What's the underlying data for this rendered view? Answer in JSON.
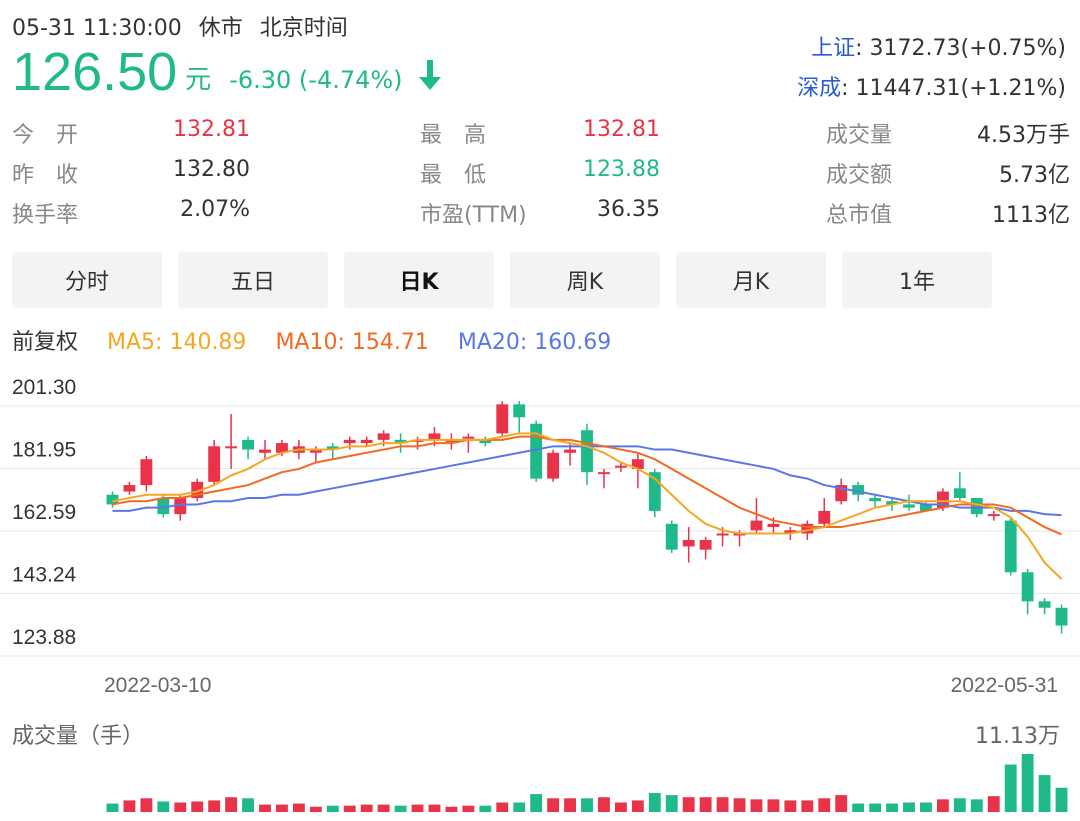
{
  "header": {
    "datetime": "05-31 11:30:00",
    "market_status": "休市",
    "timezone": "北京时间",
    "price": "126.50",
    "unit": "元",
    "change": "-6.30 (-4.74%)",
    "arrow_icon": "arrow-down-icon"
  },
  "indices": [
    {
      "name": "上证",
      "value": ": 3172.73(+0.75%)"
    },
    {
      "name": "深成",
      "value": ": 11447.31(+1.21%)"
    }
  ],
  "stats": {
    "open_label": "今　开",
    "open": "132.81",
    "prev_close_label": "昨　收",
    "prev_close": "132.80",
    "turnover_label": "换手率",
    "turnover": "2.07%",
    "high_label": "最　高",
    "high": "132.81",
    "low_label": "最　低",
    "low": "123.88",
    "pe_label": "市盈(TTM)",
    "pe": "36.35",
    "volume_label": "成交量",
    "volume": "4.53万手",
    "amount_label": "成交额",
    "amount": "5.73亿",
    "mktcap_label": "总市值",
    "mktcap": "1113亿"
  },
  "tabs": [
    "分时",
    "五日",
    "日K",
    "周K",
    "月K",
    "1年"
  ],
  "active_tab": 2,
  "ma": {
    "adjust": "前复权",
    "ma5": "MA5: 140.89",
    "ma10": "MA10: 154.71",
    "ma20": "MA20: 160.69"
  },
  "colors": {
    "up": "#e8334a",
    "down": "#1fb98b",
    "ma5": "#f5a623",
    "ma10": "#f26a21",
    "ma20": "#5b76e8"
  },
  "chart_data": {
    "type": "candlestick",
    "title": "",
    "y_ticks": [
      "201.30",
      "181.95",
      "162.59",
      "143.24",
      "123.88"
    ],
    "ylim": [
      123.88,
      201.3
    ],
    "x_labels": [
      "2022-03-10",
      "2022-05-31"
    ],
    "candles": [
      [
        167,
        164,
        168,
        163
      ],
      [
        168,
        170,
        171,
        167
      ],
      [
        170,
        178,
        179,
        168
      ],
      [
        166,
        161,
        167,
        160
      ],
      [
        161,
        166,
        167,
        159
      ],
      [
        166,
        171,
        172,
        165
      ],
      [
        171,
        182,
        184,
        170
      ],
      [
        182,
        182,
        192,
        175
      ],
      [
        184,
        181,
        185,
        178
      ],
      [
        180,
        181,
        184,
        178
      ],
      [
        180,
        183,
        184,
        179
      ],
      [
        180,
        182,
        184,
        178
      ],
      [
        180,
        181,
        182,
        177
      ],
      [
        182,
        181,
        183,
        178
      ],
      [
        183,
        184,
        185,
        181
      ],
      [
        183,
        184,
        185,
        182
      ],
      [
        184,
        186,
        187,
        182
      ],
      [
        184,
        183,
        186,
        180
      ],
      [
        184,
        184,
        185,
        181
      ],
      [
        184,
        186,
        188,
        182
      ],
      [
        184,
        184,
        186,
        181
      ],
      [
        185,
        185,
        186,
        180
      ],
      [
        184,
        183,
        185,
        182
      ],
      [
        186,
        195,
        196,
        185
      ],
      [
        195,
        191,
        196,
        186
      ],
      [
        189,
        172,
        190,
        171
      ],
      [
        172,
        180,
        181,
        171
      ],
      [
        180,
        181,
        183,
        176
      ],
      [
        187,
        174,
        189,
        170
      ],
      [
        174,
        174,
        175,
        169
      ],
      [
        176,
        176,
        177,
        174
      ],
      [
        175,
        178,
        180,
        169
      ],
      [
        174,
        162,
        175,
        160
      ],
      [
        158,
        150,
        159,
        149
      ],
      [
        151,
        153,
        157,
        146
      ],
      [
        150,
        153,
        154,
        147
      ],
      [
        155,
        155,
        157,
        151
      ],
      [
        155,
        155,
        156,
        151
      ],
      [
        156,
        159,
        166,
        155
      ],
      [
        157,
        158,
        160,
        155
      ],
      [
        155,
        156,
        157,
        153
      ],
      [
        155,
        158,
        159,
        153
      ],
      [
        158,
        162,
        166,
        157
      ],
      [
        165,
        170,
        172,
        164
      ],
      [
        170,
        167,
        171,
        165
      ],
      [
        166,
        165,
        167,
        163
      ],
      [
        165,
        164,
        166,
        162
      ],
      [
        164,
        163,
        167,
        162
      ],
      [
        164,
        162,
        165,
        162
      ],
      [
        163,
        168,
        169,
        162
      ],
      [
        169,
        166,
        174,
        165
      ],
      [
        166,
        161,
        166,
        160
      ],
      [
        161,
        161,
        162,
        159
      ],
      [
        159,
        143,
        160,
        142
      ],
      [
        143,
        134,
        144,
        130
      ],
      [
        134,
        132,
        135,
        130
      ],
      [
        132,
        126.5,
        133,
        124
      ]
    ],
    "ma5": [
      165,
      166,
      167,
      167,
      167,
      168,
      170,
      173,
      175,
      178,
      180,
      181,
      181,
      181,
      182,
      182,
      183,
      183,
      184,
      184,
      184,
      184,
      184,
      185,
      186,
      186,
      184,
      183,
      182,
      180,
      177,
      175,
      172,
      167,
      162,
      158,
      156,
      155,
      155,
      155,
      155,
      156,
      157,
      159,
      161,
      163,
      164,
      165,
      165,
      165,
      165,
      164,
      163,
      160,
      154,
      146,
      140.89
    ],
    "ma10": [
      164,
      165,
      165,
      166,
      166,
      167,
      168,
      169,
      170,
      172,
      174,
      175,
      177,
      178,
      179,
      180,
      181,
      182,
      182,
      183,
      183,
      184,
      184,
      184,
      185,
      185,
      184,
      184,
      183,
      182,
      181,
      180,
      178,
      175,
      172,
      169,
      166,
      163,
      161,
      159,
      158,
      157,
      157,
      157,
      158,
      159,
      160,
      161,
      162,
      163,
      164,
      164,
      164,
      163,
      160,
      157,
      154.71
    ],
    "ma20": [
      162,
      162,
      163,
      163,
      164,
      164,
      165,
      165,
      166,
      166,
      167,
      167,
      168,
      169,
      170,
      171,
      172,
      173,
      174,
      175,
      176,
      177,
      178,
      179,
      180,
      181,
      182,
      182,
      182,
      182,
      182,
      182,
      181,
      181,
      180,
      179,
      178,
      177,
      176,
      175,
      173,
      172,
      170,
      169,
      168,
      167,
      166,
      165,
      164,
      164,
      163,
      163,
      163,
      162,
      162,
      161,
      160.69
    ]
  },
  "volume": {
    "title": "成交量（手）",
    "max_label": "11.13万",
    "values": [
      0.8,
      1.1,
      1.3,
      1.0,
      0.9,
      1.0,
      1.1,
      1.4,
      1.3,
      0.7,
      0.7,
      0.8,
      0.5,
      0.6,
      0.6,
      0.7,
      0.7,
      0.6,
      0.7,
      0.7,
      0.5,
      0.6,
      0.6,
      0.9,
      0.9,
      1.7,
      1.3,
      1.3,
      1.3,
      1.4,
      0.9,
      1.1,
      1.8,
      1.6,
      1.4,
      1.4,
      1.4,
      1.3,
      1.2,
      1.2,
      1.1,
      1.1,
      1.3,
      1.6,
      0.8,
      0.8,
      0.8,
      0.9,
      0.9,
      1.2,
      1.3,
      1.2,
      1.5,
      4.5,
      5.5,
      3.5,
      2.3
    ]
  }
}
